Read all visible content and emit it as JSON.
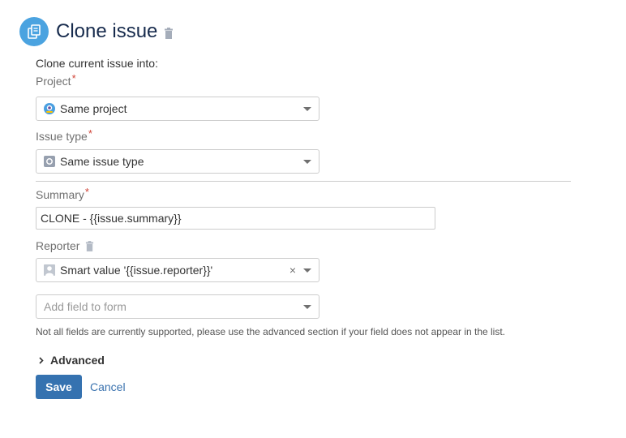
{
  "header": {
    "title": "Clone issue",
    "icon": "clone-issue-icon",
    "icon_bg": "#4ba3e0"
  },
  "form": {
    "intro": "Clone current issue into:",
    "required_marker": "*",
    "project": {
      "label": "Project",
      "value": "Same project",
      "icon": "project-avatar-icon"
    },
    "issue_type": {
      "label": "Issue type",
      "value": "Same issue type",
      "icon": "issue-type-icon"
    },
    "summary": {
      "label": "Summary",
      "value": "CLONE - {{issue.summary}}"
    },
    "reporter": {
      "label": "Reporter",
      "value": "Smart value '{{issue.reporter}}'",
      "clear": "×",
      "icon": "user-avatar-icon"
    },
    "add_field": {
      "placeholder": "Add field to form"
    },
    "help": "Not all fields are currently supported, please use the advanced section if your field does not appear in the list.",
    "advanced": "Advanced",
    "save": "Save",
    "cancel": "Cancel"
  },
  "colors": {
    "primary": "#3572b0",
    "link": "#3b73af",
    "required": "#d04437",
    "border": "#cccccc"
  }
}
